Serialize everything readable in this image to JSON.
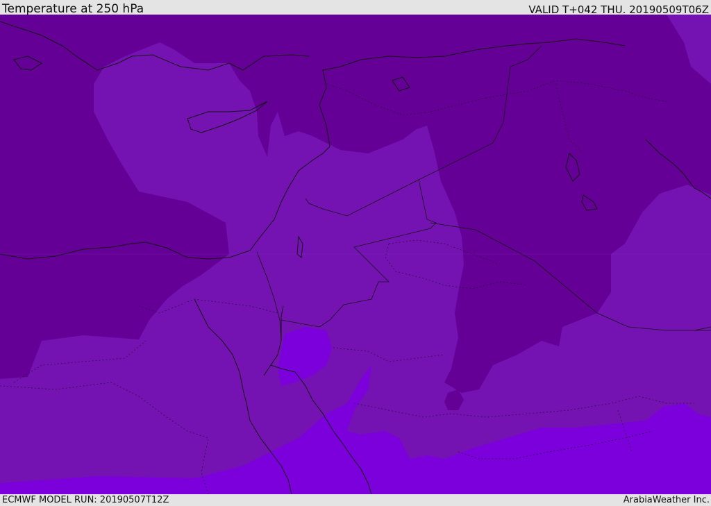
{
  "header": {
    "title": "Temperature at 250 hPa",
    "valid": "VALID T+042 THU. 20190509T06Z"
  },
  "footer": {
    "model_run": "ECMWF MODEL RUN: 20190507T12Z",
    "credit": "ArabiaWeather Inc."
  },
  "colors": {
    "zone_coldest": "#640096",
    "zone_cold": "#7412b2",
    "zone_mild": "#7c00dc",
    "boundary": "#141414"
  }
}
